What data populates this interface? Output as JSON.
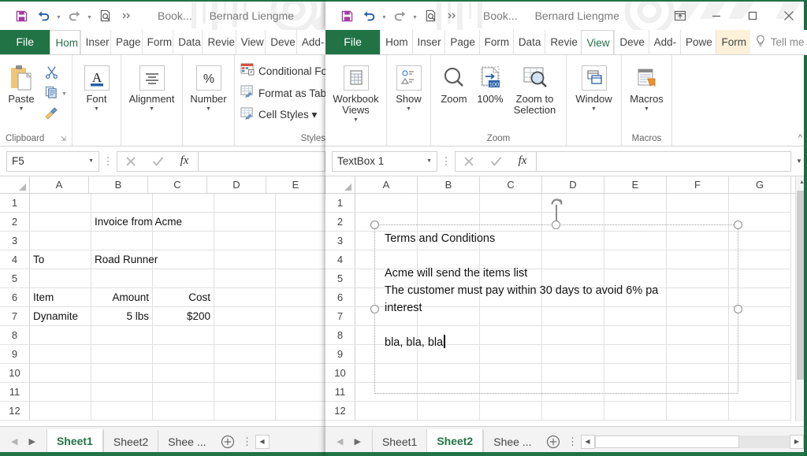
{
  "left_window": {
    "title": "Book...",
    "user": "Bernard Liengme",
    "quick_access": [
      "save-icon",
      "undo-icon",
      "redo-icon",
      "print-preview-icon",
      "more-icon"
    ],
    "ribbon_tabs": [
      {
        "label": "File",
        "state": "file"
      },
      {
        "label": "Hom",
        "state": "active"
      },
      {
        "label": "Inser",
        "state": "normal"
      },
      {
        "label": "Page",
        "state": "normal"
      },
      {
        "label": "Form",
        "state": "normal"
      },
      {
        "label": "Data",
        "state": "normal"
      },
      {
        "label": "Revie",
        "state": "normal"
      },
      {
        "label": "View",
        "state": "normal"
      },
      {
        "label": "Deve",
        "state": "normal"
      },
      {
        "label": "Add-",
        "state": "normal"
      }
    ],
    "ribbon_groups": [
      {
        "name": "Clipboard",
        "label": "Clipboard",
        "big": {
          "label": "Paste",
          "caret": "▼"
        },
        "mini": [
          "cut-icon",
          "copy-icon",
          "format-painter-icon"
        ]
      },
      {
        "name": "Font",
        "label": "",
        "big": {
          "label": "Font",
          "caret": "▼"
        }
      },
      {
        "name": "Alignment",
        "label": "",
        "big": {
          "label": "Alignment",
          "caret": "▼"
        }
      },
      {
        "name": "Number",
        "label": "",
        "big": {
          "label": "Number",
          "caret": "▼"
        }
      },
      {
        "name": "Styles",
        "label": "Styles",
        "items": [
          "Conditional For",
          "Format as Table",
          "Cell Styles ▾"
        ]
      }
    ],
    "namebox": {
      "value": "F5",
      "caret": "▼"
    },
    "formula_bar": {
      "value": "",
      "cancel": "✕",
      "enter": "✓",
      "fx": "fx"
    },
    "columns": [
      "A",
      "B",
      "C",
      "D",
      "E"
    ],
    "rows": [
      "1",
      "2",
      "3",
      "4",
      "5",
      "6",
      "7",
      "8",
      "9",
      "10",
      "11",
      "12"
    ],
    "cells": {
      "2": {
        "B": "Invoice from Acme"
      },
      "4": {
        "A": "To",
        "B": "Road Runner"
      },
      "6": {
        "A": "Item",
        "B": "Amount",
        "C": "Cost"
      },
      "7": {
        "A": "Dynamite",
        "B": "5 lbs",
        "C": "$200"
      }
    },
    "cell_align": {
      "6": {
        "B": "r",
        "C": "r"
      },
      "7": {
        "B": "r",
        "C": "r"
      }
    },
    "sheet_tabs": [
      {
        "label": "Sheet1",
        "active": true
      },
      {
        "label": "Sheet2",
        "active": false
      },
      {
        "label": "Shee ...",
        "active": false
      }
    ],
    "add_sheet": "⊕",
    "tab_menu": "⋮"
  },
  "right_window": {
    "title": "Book...",
    "user": "Bernard Liengme",
    "quick_access": [
      "save-icon",
      "undo-icon",
      "redo-icon",
      "print-preview-icon",
      "more-icon"
    ],
    "window_controls": [
      "ribbon-display-options-icon",
      "minimize-icon",
      "maximize-icon",
      "close-icon"
    ],
    "ribbon_tabs": [
      {
        "label": "File",
        "state": "file"
      },
      {
        "label": "Hom",
        "state": "normal"
      },
      {
        "label": "Inser",
        "state": "normal"
      },
      {
        "label": "Page",
        "state": "normal"
      },
      {
        "label": "Form",
        "state": "normal"
      },
      {
        "label": "Data",
        "state": "normal"
      },
      {
        "label": "Revie",
        "state": "normal"
      },
      {
        "label": "View",
        "state": "active"
      },
      {
        "label": "Deve",
        "state": "normal"
      },
      {
        "label": "Add-",
        "state": "normal"
      },
      {
        "label": "Powe",
        "state": "normal"
      },
      {
        "label": "Form",
        "state": "highlight"
      }
    ],
    "tell_me": "Tell me",
    "ribbon_groups": [
      {
        "name": "Workbook Views",
        "label": "",
        "buttons": [
          {
            "label": "Workbook Views",
            "caret": "▼",
            "icon": "workbook-views-icon"
          }
        ]
      },
      {
        "name": "Show",
        "label": "",
        "buttons": [
          {
            "label": "Show",
            "caret": "▼",
            "icon": "show-icon"
          }
        ]
      },
      {
        "name": "Zoom",
        "label": "Zoom",
        "buttons": [
          {
            "label": "Zoom",
            "caret": "",
            "icon": "zoom-icon"
          },
          {
            "label": "100%",
            "caret": "",
            "icon": "zoom-100-icon"
          },
          {
            "label": "Zoom to Selection",
            "caret": "",
            "icon": "zoom-to-selection-icon"
          }
        ]
      },
      {
        "name": "Window",
        "label": "",
        "buttons": [
          {
            "label": "Window",
            "caret": "▼",
            "icon": "window-icon"
          }
        ]
      },
      {
        "name": "Macros",
        "label": "Macros",
        "buttons": [
          {
            "label": "Macros",
            "caret": "▼",
            "icon": "macros-icon"
          }
        ]
      }
    ],
    "collapse_ribbon": "^",
    "namebox": {
      "value": "TextBox 1",
      "caret": "▼"
    },
    "formula_bar": {
      "value": "",
      "cancel": "✕",
      "enter": "✓",
      "fx": "fx"
    },
    "columns": [
      "A",
      "B",
      "C",
      "D",
      "E",
      "F",
      "G"
    ],
    "rows": [
      "1",
      "2",
      "3",
      "4",
      "5",
      "6",
      "7",
      "8",
      "9",
      "10",
      "11",
      "12"
    ],
    "textbox": {
      "name": "TextBox 1",
      "lines": [
        "Terms and Conditions",
        "",
        "Acme will send the items list",
        "The customer must pay within 30 days to avoid 6% pa",
        "interest",
        "",
        "bla, bla, bla"
      ],
      "caret_on_line": 6,
      "handles": 8,
      "rotation_handle": "rotation-handle"
    },
    "sheet_tabs": [
      {
        "label": "Sheet1",
        "active": false
      },
      {
        "label": "Sheet2",
        "active": true
      },
      {
        "label": "Shee ...",
        "active": false
      }
    ],
    "add_sheet": "⊕",
    "tab_menu": "⋮"
  },
  "colors": {
    "excel_green": "#217346",
    "status_green": "#217346",
    "file_tab": "#217346",
    "highlight_tab": "#fdf2d9",
    "grid_line": "#e0e0e0",
    "header_text": "#444444"
  }
}
